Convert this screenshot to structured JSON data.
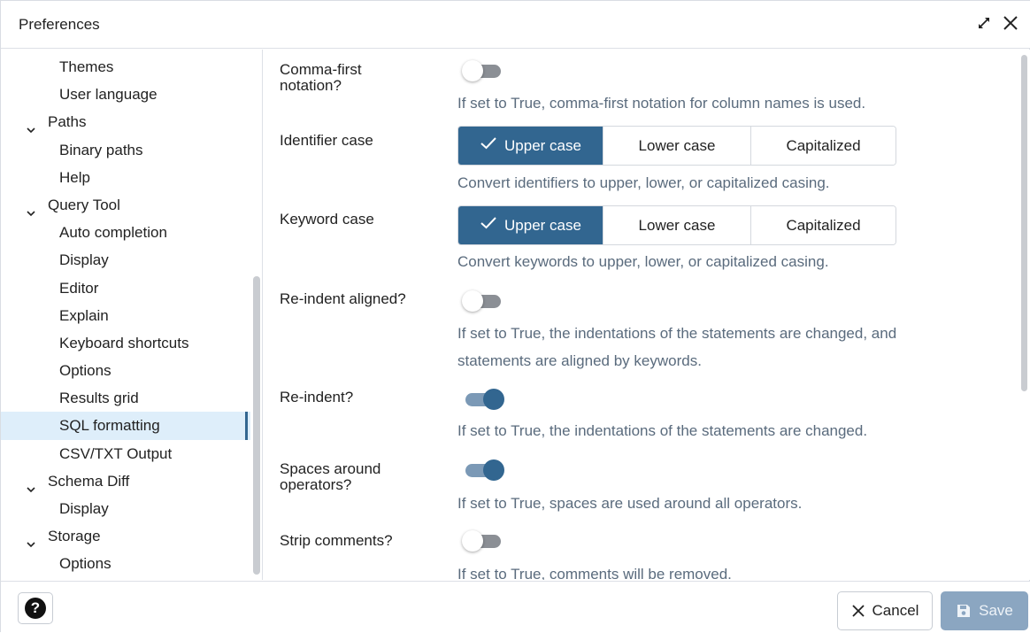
{
  "window": {
    "title": "Preferences"
  },
  "sidebar": {
    "items": [
      {
        "label": "Themes",
        "level": 1
      },
      {
        "label": "User language",
        "level": 1
      },
      {
        "label": "Paths",
        "level": 0,
        "expanded": true
      },
      {
        "label": "Binary paths",
        "level": 1
      },
      {
        "label": "Help",
        "level": 1
      },
      {
        "label": "Query Tool",
        "level": 0,
        "expanded": true
      },
      {
        "label": "Auto completion",
        "level": 1
      },
      {
        "label": "Display",
        "level": 1
      },
      {
        "label": "Editor",
        "level": 1
      },
      {
        "label": "Explain",
        "level": 1
      },
      {
        "label": "Keyboard shortcuts",
        "level": 1
      },
      {
        "label": "Options",
        "level": 1
      },
      {
        "label": "Results grid",
        "level": 1
      },
      {
        "label": "SQL formatting",
        "level": 1,
        "selected": true
      },
      {
        "label": "CSV/TXT Output",
        "level": 1
      },
      {
        "label": "Schema Diff",
        "level": 0,
        "expanded": true
      },
      {
        "label": "Display",
        "level": 1
      },
      {
        "label": "Storage",
        "level": 0,
        "expanded": true
      },
      {
        "label": "Options",
        "level": 1
      }
    ]
  },
  "settings": {
    "comma_first": {
      "label_line1": "Comma-first",
      "label_line2": "notation?",
      "value": false,
      "help": "If set to True, comma-first notation for column names is used."
    },
    "identifier_case": {
      "label": "Identifier case",
      "options": [
        "Upper case",
        "Lower case",
        "Capitalized"
      ],
      "selected": "Upper case",
      "help": "Convert identifiers to upper, lower, or capitalized casing."
    },
    "keyword_case": {
      "label": "Keyword case",
      "options": [
        "Upper case",
        "Lower case",
        "Capitalized"
      ],
      "selected": "Upper case",
      "help": "Convert keywords to upper, lower, or capitalized casing."
    },
    "reindent_aligned": {
      "label": "Re-indent aligned?",
      "value": false,
      "help_line1": "If set to True, the indentations of the statements are changed, and",
      "help_line2": "statements are aligned by keywords."
    },
    "reindent": {
      "label": "Re-indent?",
      "value": true,
      "help": "If set to True, the indentations of the statements are changed."
    },
    "spaces_around_operators": {
      "label_line1": "Spaces around",
      "label_line2": "operators?",
      "value": true,
      "help": "If set to True, spaces are used around all operators."
    },
    "strip_comments": {
      "label": "Strip comments?",
      "value": false,
      "help": "If set to True, comments will be removed."
    }
  },
  "footer": {
    "help_glyph": "?",
    "cancel_label": "Cancel",
    "save_label": "Save"
  },
  "colors": {
    "accent": "#326690",
    "selected_bg": "#deeefa",
    "help_text": "#5a6b7d",
    "save_disabled": "#8ba6c1"
  },
  "icons": {
    "maximize": "expand-icon",
    "close": "close-icon",
    "chevron": "chevron-down-icon",
    "check": "check-icon",
    "help": "question-circle-icon",
    "cancel": "x-icon",
    "save": "floppy-disk-icon"
  }
}
